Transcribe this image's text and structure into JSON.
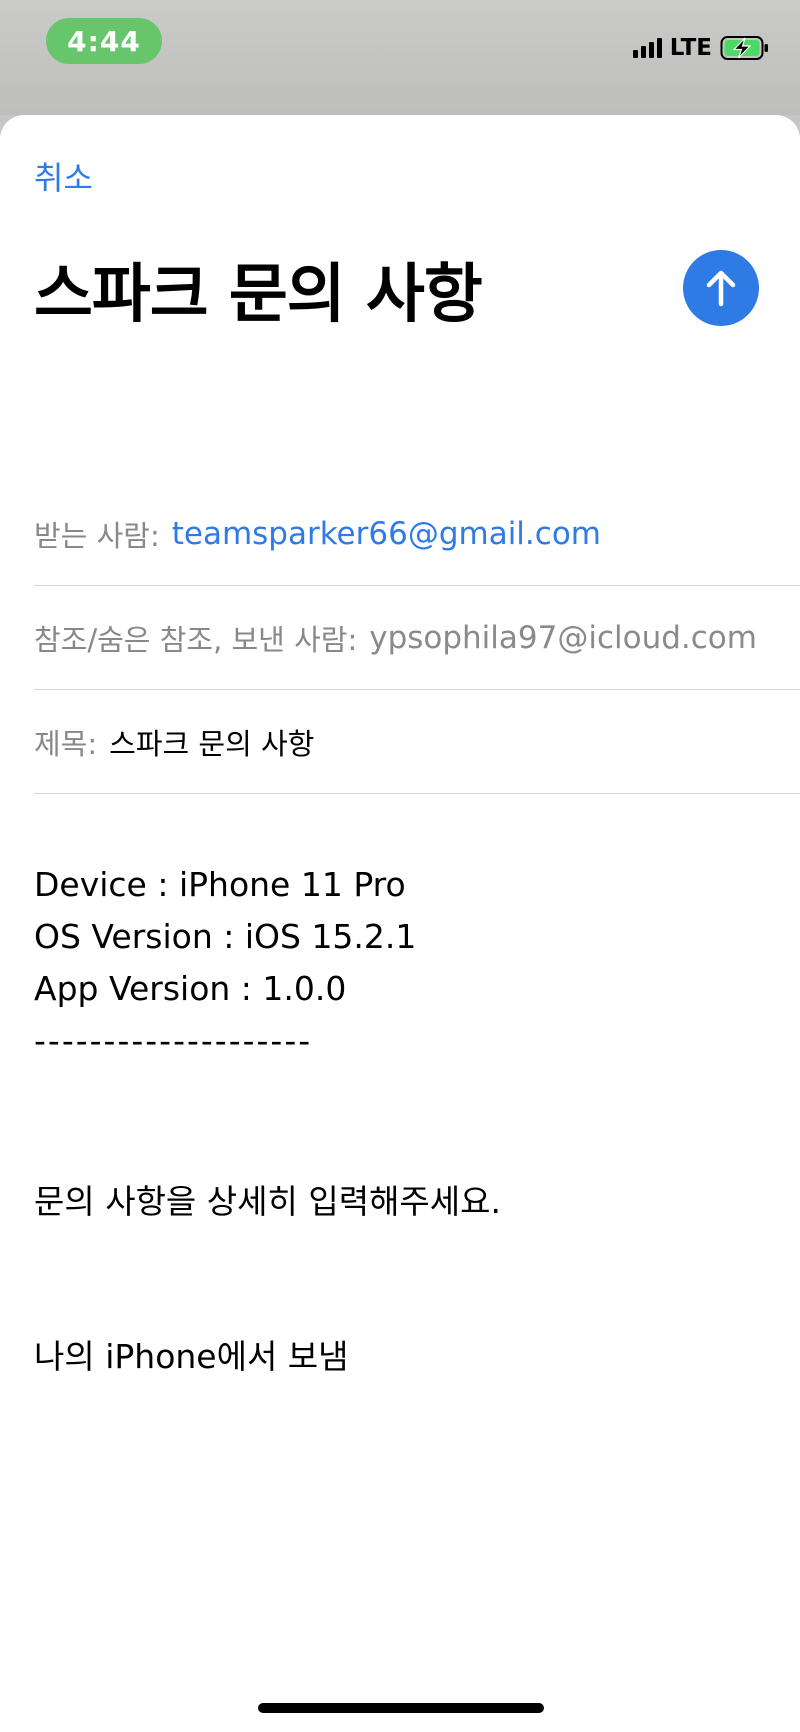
{
  "status_bar": {
    "time": "4:44",
    "network": "LTE",
    "icons": [
      "signal-icon",
      "battery-charging-icon"
    ]
  },
  "compose": {
    "cancel_label": "취소",
    "title": "스파크 문의 사항",
    "send_icon": "arrow-up-icon",
    "to_label": "받는 사람:",
    "to_value": "teamsparker66@gmail.com",
    "cc_label": "참조/숨은 참조, 보낸 사람:",
    "cc_value": "ypsophila97@icloud.com",
    "subject_label": "제목:",
    "subject_value": "스파크 문의 사항"
  },
  "body": {
    "lines": [
      "Device : iPhone 11 Pro",
      "OS Version : iOS 15.2.1",
      "App Version : 1.0.0",
      "--------------------",
      "문의 사항을 상세히 입력해주세요.",
      "나의 iPhone에서 보냄"
    ]
  },
  "colors": {
    "accent": "#2f7be5",
    "time_pill": "#67c56b",
    "battery": "#4cd964"
  }
}
